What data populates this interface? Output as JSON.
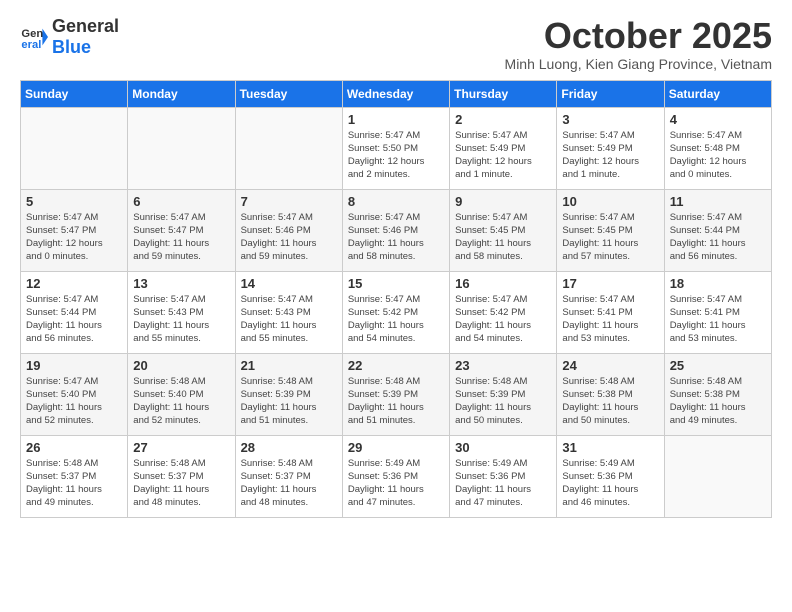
{
  "header": {
    "logo_general": "General",
    "logo_blue": "Blue",
    "month_title": "October 2025",
    "location": "Minh Luong, Kien Giang Province, Vietnam"
  },
  "days_of_week": [
    "Sunday",
    "Monday",
    "Tuesday",
    "Wednesday",
    "Thursday",
    "Friday",
    "Saturday"
  ],
  "weeks": [
    [
      {
        "day": "",
        "info": ""
      },
      {
        "day": "",
        "info": ""
      },
      {
        "day": "",
        "info": ""
      },
      {
        "day": "1",
        "info": "Sunrise: 5:47 AM\nSunset: 5:50 PM\nDaylight: 12 hours\nand 2 minutes."
      },
      {
        "day": "2",
        "info": "Sunrise: 5:47 AM\nSunset: 5:49 PM\nDaylight: 12 hours\nand 1 minute."
      },
      {
        "day": "3",
        "info": "Sunrise: 5:47 AM\nSunset: 5:49 PM\nDaylight: 12 hours\nand 1 minute."
      },
      {
        "day": "4",
        "info": "Sunrise: 5:47 AM\nSunset: 5:48 PM\nDaylight: 12 hours\nand 0 minutes."
      }
    ],
    [
      {
        "day": "5",
        "info": "Sunrise: 5:47 AM\nSunset: 5:47 PM\nDaylight: 12 hours\nand 0 minutes."
      },
      {
        "day": "6",
        "info": "Sunrise: 5:47 AM\nSunset: 5:47 PM\nDaylight: 11 hours\nand 59 minutes."
      },
      {
        "day": "7",
        "info": "Sunrise: 5:47 AM\nSunset: 5:46 PM\nDaylight: 11 hours\nand 59 minutes."
      },
      {
        "day": "8",
        "info": "Sunrise: 5:47 AM\nSunset: 5:46 PM\nDaylight: 11 hours\nand 58 minutes."
      },
      {
        "day": "9",
        "info": "Sunrise: 5:47 AM\nSunset: 5:45 PM\nDaylight: 11 hours\nand 58 minutes."
      },
      {
        "day": "10",
        "info": "Sunrise: 5:47 AM\nSunset: 5:45 PM\nDaylight: 11 hours\nand 57 minutes."
      },
      {
        "day": "11",
        "info": "Sunrise: 5:47 AM\nSunset: 5:44 PM\nDaylight: 11 hours\nand 56 minutes."
      }
    ],
    [
      {
        "day": "12",
        "info": "Sunrise: 5:47 AM\nSunset: 5:44 PM\nDaylight: 11 hours\nand 56 minutes."
      },
      {
        "day": "13",
        "info": "Sunrise: 5:47 AM\nSunset: 5:43 PM\nDaylight: 11 hours\nand 55 minutes."
      },
      {
        "day": "14",
        "info": "Sunrise: 5:47 AM\nSunset: 5:43 PM\nDaylight: 11 hours\nand 55 minutes."
      },
      {
        "day": "15",
        "info": "Sunrise: 5:47 AM\nSunset: 5:42 PM\nDaylight: 11 hours\nand 54 minutes."
      },
      {
        "day": "16",
        "info": "Sunrise: 5:47 AM\nSunset: 5:42 PM\nDaylight: 11 hours\nand 54 minutes."
      },
      {
        "day": "17",
        "info": "Sunrise: 5:47 AM\nSunset: 5:41 PM\nDaylight: 11 hours\nand 53 minutes."
      },
      {
        "day": "18",
        "info": "Sunrise: 5:47 AM\nSunset: 5:41 PM\nDaylight: 11 hours\nand 53 minutes."
      }
    ],
    [
      {
        "day": "19",
        "info": "Sunrise: 5:47 AM\nSunset: 5:40 PM\nDaylight: 11 hours\nand 52 minutes."
      },
      {
        "day": "20",
        "info": "Sunrise: 5:48 AM\nSunset: 5:40 PM\nDaylight: 11 hours\nand 52 minutes."
      },
      {
        "day": "21",
        "info": "Sunrise: 5:48 AM\nSunset: 5:39 PM\nDaylight: 11 hours\nand 51 minutes."
      },
      {
        "day": "22",
        "info": "Sunrise: 5:48 AM\nSunset: 5:39 PM\nDaylight: 11 hours\nand 51 minutes."
      },
      {
        "day": "23",
        "info": "Sunrise: 5:48 AM\nSunset: 5:39 PM\nDaylight: 11 hours\nand 50 minutes."
      },
      {
        "day": "24",
        "info": "Sunrise: 5:48 AM\nSunset: 5:38 PM\nDaylight: 11 hours\nand 50 minutes."
      },
      {
        "day": "25",
        "info": "Sunrise: 5:48 AM\nSunset: 5:38 PM\nDaylight: 11 hours\nand 49 minutes."
      }
    ],
    [
      {
        "day": "26",
        "info": "Sunrise: 5:48 AM\nSunset: 5:37 PM\nDaylight: 11 hours\nand 49 minutes."
      },
      {
        "day": "27",
        "info": "Sunrise: 5:48 AM\nSunset: 5:37 PM\nDaylight: 11 hours\nand 48 minutes."
      },
      {
        "day": "28",
        "info": "Sunrise: 5:48 AM\nSunset: 5:37 PM\nDaylight: 11 hours\nand 48 minutes."
      },
      {
        "day": "29",
        "info": "Sunrise: 5:49 AM\nSunset: 5:36 PM\nDaylight: 11 hours\nand 47 minutes."
      },
      {
        "day": "30",
        "info": "Sunrise: 5:49 AM\nSunset: 5:36 PM\nDaylight: 11 hours\nand 47 minutes."
      },
      {
        "day": "31",
        "info": "Sunrise: 5:49 AM\nSunset: 5:36 PM\nDaylight: 11 hours\nand 46 minutes."
      },
      {
        "day": "",
        "info": ""
      }
    ]
  ]
}
